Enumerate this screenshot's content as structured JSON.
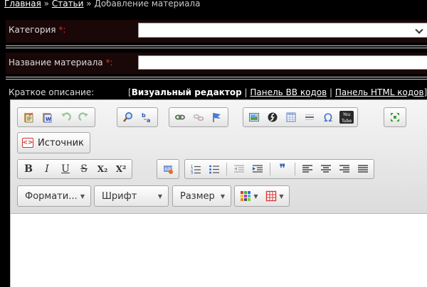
{
  "breadcrumb": {
    "home": "Главная",
    "articles": "Статьи",
    "separator": "»",
    "current": "Добавление материала"
  },
  "form": {
    "category_label": "Категория",
    "title_label": "Название материала",
    "required_mark": "*:",
    "category_value": "",
    "title_value": ""
  },
  "description": {
    "label": "Краткое описание:",
    "mode_visual": "Визуальный редактор",
    "mode_bb": "Панель BB кодов",
    "mode_html": "Панель HTML кодов",
    "separator": "|"
  },
  "editor": {
    "source_label": "Источник",
    "format_label": "Формати...",
    "font_label": "Шрифт",
    "size_label": "Размер",
    "btn_bold": "B",
    "btn_italic": "I",
    "btn_underline": "U",
    "btn_strike": "S",
    "btn_subscript": "X₂",
    "btn_superscript": "X²",
    "btn_omega": "Ω",
    "btn_quote": "❞",
    "btn_youtube": "You Tube"
  },
  "icons": {
    "paste": "paste-icon",
    "paste_word": "paste-word-icon",
    "undo": "undo-icon",
    "redo": "redo-icon",
    "find": "find-icon",
    "replace": "replace-icon",
    "link": "link-icon",
    "unlink": "unlink-icon",
    "anchor": "anchor-icon",
    "image": "image-icon",
    "flash": "flash-icon",
    "table": "table-icon",
    "hr": "horizontal-rule-icon",
    "special_char": "omega-icon",
    "youtube": "youtube-icon",
    "maximize": "maximize-icon",
    "source": "source-icon",
    "remove_format": "remove-format-icon",
    "numbered_list": "numbered-list-icon",
    "bulleted_list": "bulleted-list-icon",
    "outdent": "outdent-icon",
    "indent": "indent-icon",
    "blockquote": "blockquote-icon",
    "align_left": "align-left-icon",
    "align_center": "align-center-icon",
    "align_right": "align-right-icon",
    "align_justify": "align-justify-icon",
    "text_color": "text-color-icon",
    "bg_color": "background-color-icon"
  },
  "colors": {
    "page_bg": "#000000",
    "row_bg": "#1a0808",
    "required": "#e32a2a",
    "link": "#ffffff",
    "toolbar_bg": "#e6e6e6"
  }
}
